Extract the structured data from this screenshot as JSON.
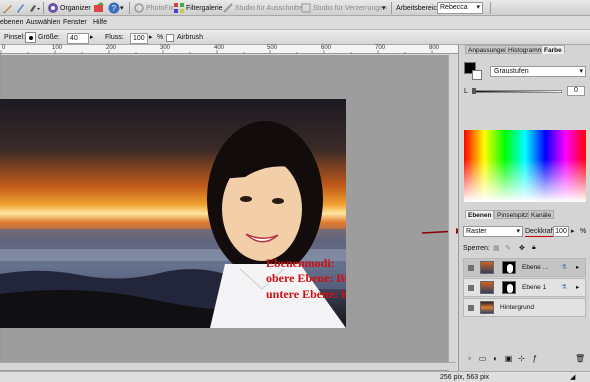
{
  "toolbar": {
    "organizer_label": "Organizer",
    "photofix_label": "PhotoFix",
    "filtergalerie_label": "Filtergalerie",
    "studio_ausschnitte_label": "Studio für Ausschnitte",
    "studio_verzerrungen_label": "Studio für Verzerrungen",
    "workspace_label": "Arbeitsbereich:",
    "workspace_value": "Rebecca",
    "help_icon": "help-icon"
  },
  "menu": {
    "items": [
      "ebenen",
      "Auswählen",
      "Fenster",
      "Hilfe"
    ]
  },
  "options": {
    "brush_label": "Pinsel:",
    "size_label": "Größe:",
    "size_value": "40",
    "flow_label": "Fluss:",
    "flow_value": "100",
    "flow_unit": "%",
    "airbrush_label": "Airbrush"
  },
  "ruler": {
    "labels": [
      "0",
      "100",
      "200",
      "300",
      "400",
      "500",
      "600",
      "700",
      "800"
    ]
  },
  "canvas": {
    "note_line1": "Ebenenmodi:",
    "note_line2": "obere Ebene: Bildschirm",
    "note_line3": "untere Ebene: hartes Licht"
  },
  "status": {
    "dimensions": "256 pix, 563 pix"
  },
  "panel": {
    "top_tabs": [
      "Anpassungen",
      "Histogramm",
      "Farbe"
    ],
    "color_mode": "Graustufen",
    "l_label": "L",
    "l_value": "0",
    "layer_tabs": [
      "Ebenen",
      "Pinselspitze",
      "Kanäle"
    ],
    "blend_mode": "Raster",
    "opacity_label": "Deckkraft:",
    "opacity_value": "100",
    "opacity_unit": "%",
    "lock_label": "Sperren:",
    "layers": [
      {
        "name": "Ebene ..."
      },
      {
        "name": "Ebene 1"
      },
      {
        "name": "Hintergrund"
      }
    ]
  },
  "colors": {
    "accent_red": "#d01010",
    "arrow": "#8b0000"
  }
}
